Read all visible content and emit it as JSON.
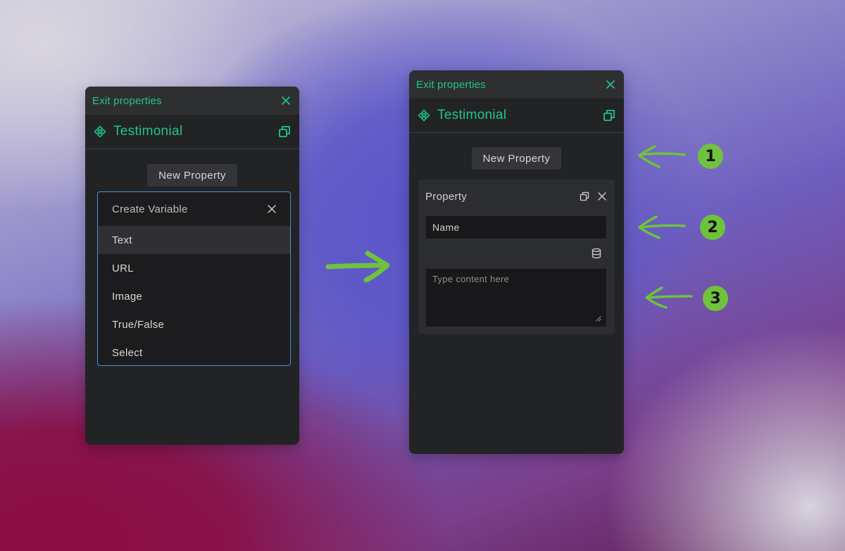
{
  "left_panel": {
    "topbar_title": "Exit properties",
    "component_title": "Testimonial",
    "new_property_label": "New Property",
    "dropdown": {
      "title": "Create Variable",
      "items": [
        "Text",
        "URL",
        "Image",
        "True/False",
        "Select"
      ],
      "active_item": "Text"
    }
  },
  "right_panel": {
    "topbar_title": "Exit properties",
    "component_title": "Testimonial",
    "new_property_label": "New Property",
    "property_card": {
      "title": "Property",
      "name_value": "Name",
      "content_placeholder": "Type content here"
    }
  },
  "annotations": {
    "badges": [
      "1",
      "2",
      "3"
    ]
  },
  "colors": {
    "accent_green": "#21c58a",
    "annotation_green": "#6fc23c",
    "focus_blue": "#4a90d9",
    "panel_bg": "#222325"
  },
  "icons": [
    "close-icon",
    "component-icon",
    "duplicate-icon",
    "database-icon",
    "resize-grip-icon",
    "arrow-annotation"
  ]
}
